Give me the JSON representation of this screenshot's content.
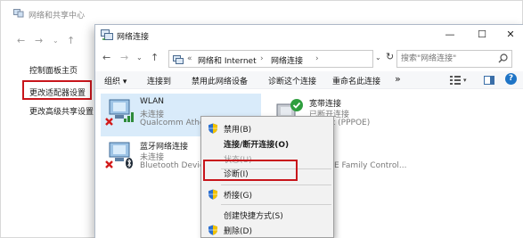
{
  "background_window": {
    "title": "网络和共享中心",
    "nav": {
      "back": "←",
      "forward": "→",
      "dropdown": "⌄",
      "up": "↑"
    },
    "sidebar": [
      {
        "label": "控制面板主页"
      },
      {
        "label": "更改适配器设置",
        "highlighted": true
      },
      {
        "label": "更改高级共享设置"
      }
    ]
  },
  "window": {
    "title": "网络连接",
    "controls": {
      "minimize": "—",
      "maximize": "☐",
      "close": "✕"
    },
    "address": {
      "back": "←",
      "forward": "→",
      "recent": "⌄",
      "up": "↑",
      "overflow": "«",
      "crumbs": [
        "网络和 Internet",
        "›",
        "网络连接",
        "›"
      ],
      "dropdown": "⌄",
      "refresh": "↻"
    },
    "search": {
      "placeholder": "搜索\"网络连接\""
    },
    "toolbar": {
      "organize": "组织 ▾",
      "connect": "连接到",
      "disable": "禁用此网络设备",
      "diagnose": "诊断这个连接",
      "rename": "重命名此连接",
      "more": "»",
      "view": "▾",
      "help": "?"
    },
    "items": [
      {
        "name": "WLAN",
        "status": "未连接",
        "device": "Qualcomm Athe",
        "selected": true,
        "icon": "wifi-adapter-icon"
      },
      {
        "name": "宽带连接",
        "status": "已断开连接",
        "device": "Iniport (PPPOE)",
        "selected": false,
        "icon": "broadband-icon"
      },
      {
        "name": "蓝牙网络连接",
        "status": "未连接",
        "device": "Bluetooth Devic",
        "selected": false,
        "icon": "bluetooth-adapter-icon"
      },
      {
        "name": "",
        "status": "",
        "device": "PCIe FE Family Control...",
        "selected": false,
        "icon": "ethernet-adapter-icon"
      }
    ]
  },
  "context_menu": {
    "items": [
      {
        "label": "禁用(B)",
        "style": "normal",
        "icon": "shield-icon"
      },
      {
        "label": "连接/断开连接(O)",
        "style": "bold",
        "icon": ""
      },
      {
        "label": "状态(U)",
        "style": "disabled",
        "icon": ""
      },
      {
        "label": "诊断(I)",
        "style": "normal",
        "icon": "",
        "highlighted": true
      },
      {
        "label": "桥接(G)",
        "style": "normal",
        "icon": "shield-icon"
      },
      {
        "label": "创建快捷方式(S)",
        "style": "normal",
        "icon": ""
      },
      {
        "label": "删除(D)",
        "style": "normal",
        "icon": "shield-icon"
      }
    ]
  },
  "colors": {
    "highlight_box": "#c8151b",
    "selection": "#d9ebfa",
    "shield_blue": "#2a6fd1",
    "shield_yellow": "#f2c200",
    "error_red": "#d21b1b"
  }
}
